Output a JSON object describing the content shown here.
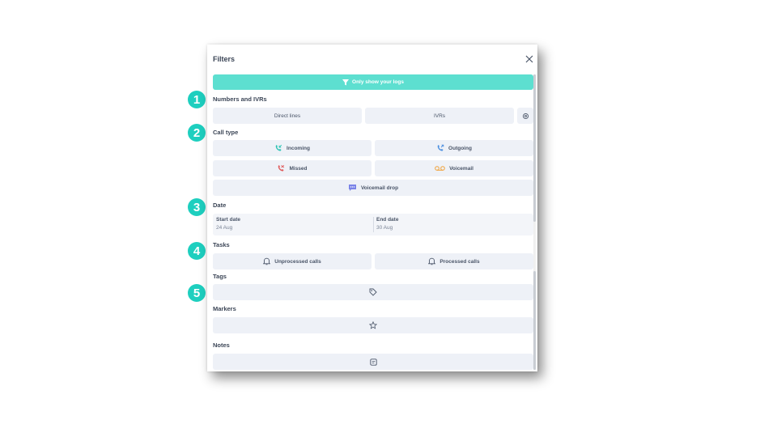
{
  "modal": {
    "title": "Filters",
    "primary_button": "Only show your logs"
  },
  "badges": [
    "1",
    "2",
    "3",
    "4",
    "5"
  ],
  "sections": {
    "numbers": "Numbers and IVRs",
    "call_type": "Call type",
    "date": "Date",
    "tasks": "Tasks",
    "tags": "Tags",
    "markers": "Markers",
    "notes": "Notes"
  },
  "numbers": {
    "direct_lines": "Direct lines",
    "ivrs": "IVRs"
  },
  "call_type": {
    "incoming": "Incoming",
    "outgoing": "Outgoing",
    "missed": "Missed",
    "voicemail": "Voicemail",
    "voicemail_drop": "Voicemail drop"
  },
  "date": {
    "start_label": "Start date",
    "start_value": "24 Aug",
    "end_label": "End date",
    "end_value": "30 Aug"
  },
  "tasks": {
    "unprocessed": "Unprocessed calls",
    "processed": "Processed calls"
  },
  "colors": {
    "accent": "#5ddfd0",
    "badge": "#1ecfbf",
    "incoming": "#2cc4b4",
    "outgoing": "#4b8fe0",
    "missed": "#e05a5a",
    "voicemail": "#f0a23a",
    "voicemail_drop": "#7b84e8"
  },
  "icons": {
    "close": "close-icon",
    "filter": "funnel-icon",
    "settings": "gear-icon",
    "incoming": "phone-incoming-icon",
    "outgoing": "phone-outgoing-icon",
    "missed": "phone-missed-icon",
    "voicemail": "voicemail-icon",
    "voicemail_drop": "chat-bubble-icon",
    "tasks": "bell-icon",
    "tags": "tag-icon",
    "markers": "star-icon",
    "notes": "note-icon"
  }
}
